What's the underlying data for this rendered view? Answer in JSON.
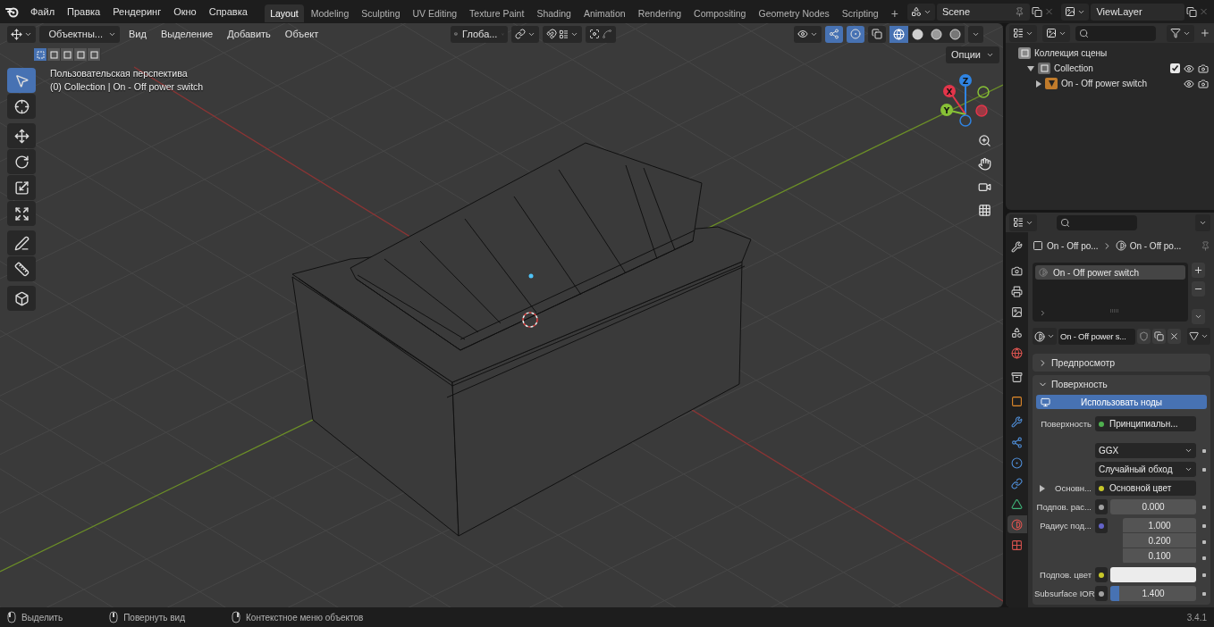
{
  "topbar": {
    "menu": [
      "Файл",
      "Правка",
      "Рендеринг",
      "Окно",
      "Справка"
    ],
    "workspaces": [
      {
        "label": "Layout",
        "selected": true
      },
      {
        "label": "Modeling",
        "selected": false
      },
      {
        "label": "Sculpting",
        "selected": false
      },
      {
        "label": "UV Editing",
        "selected": false
      },
      {
        "label": "Texture Paint",
        "selected": false
      },
      {
        "label": "Shading",
        "selected": false
      },
      {
        "label": "Animation",
        "selected": false
      },
      {
        "label": "Rendering",
        "selected": false
      },
      {
        "label": "Compositing",
        "selected": false
      },
      {
        "label": "Geometry Nodes",
        "selected": false
      },
      {
        "label": "Scripting",
        "selected": false
      }
    ],
    "add_workspace": "+",
    "scene": "Scene",
    "view_layer": "ViewLayer"
  },
  "viewport": {
    "mode": "Объектны...",
    "menus": [
      "Вид",
      "Выделение",
      "Добавить",
      "Объект"
    ],
    "orientation": "Глоба...",
    "select_modes": [
      {
        "selected": true
      },
      {
        "selected": false
      },
      {
        "selected": false
      },
      {
        "selected": false
      },
      {
        "selected": false
      }
    ],
    "gizmos_on": true,
    "overlays_on": true,
    "shading": [
      {
        "kind": "wireframe",
        "selected": true
      },
      {
        "kind": "solid",
        "selected": false
      },
      {
        "kind": "material",
        "selected": false
      },
      {
        "kind": "rendered",
        "selected": false
      }
    ],
    "options": "Опции",
    "view_name": "Пользовательская перспектива",
    "object_info": "(0) Collection | On - Off power switch",
    "tool_groups": [
      [
        {
          "kind": "select",
          "selected": true
        },
        {
          "kind": "cursor",
          "selected": false
        }
      ],
      [
        {
          "kind": "move",
          "selected": false
        },
        {
          "kind": "rotate",
          "selected": false
        },
        {
          "kind": "scale",
          "selected": false
        },
        {
          "kind": "transform",
          "selected": false
        }
      ],
      [
        {
          "kind": "annotate",
          "selected": false
        },
        {
          "kind": "measure",
          "selected": false
        }
      ],
      [
        {
          "kind": "add-cube",
          "selected": false
        }
      ]
    ],
    "axes": [
      {
        "label": "Z",
        "color": "#2f84e3"
      },
      {
        "label": "X",
        "color": "#e3354a"
      },
      {
        "label": "Y",
        "color": "#87c136"
      }
    ]
  },
  "outliner": {
    "items": [
      {
        "kind": "scene-collection",
        "label": "Коллекция сцены",
        "children": [
          {
            "kind": "collection",
            "label": "Collection",
            "expanded": true,
            "checked": true,
            "children": [
              {
                "kind": "object",
                "label": "On - Off power switch",
                "expanded": false
              }
            ]
          }
        ]
      }
    ]
  },
  "properties": {
    "breadcrumb": [
      "On - Off po...",
      "On - Off po..."
    ],
    "tabs": [
      {
        "kind": "tool",
        "selected": false
      },
      {
        "kind": "render",
        "selected": false
      },
      {
        "kind": "output",
        "selected": false
      },
      {
        "kind": "view-layer",
        "selected": false
      },
      {
        "kind": "scene",
        "selected": false
      },
      {
        "kind": "world",
        "selected": false
      },
      {
        "kind": "collection",
        "selected": false
      },
      {
        "kind": "object",
        "selected": false
      },
      {
        "kind": "modifiers",
        "selected": false
      },
      {
        "kind": "particles",
        "selected": false
      },
      {
        "kind": "physics",
        "selected": false
      },
      {
        "kind": "constraints",
        "selected": false
      },
      {
        "kind": "data",
        "selected": false
      },
      {
        "kind": "material",
        "selected": true
      },
      {
        "kind": "texture",
        "selected": false
      }
    ],
    "slots": [
      {
        "label": "On - Off power switch",
        "selected": true
      }
    ],
    "material": "On - Off power s...",
    "panels": [
      {
        "label": "Предпросмотр",
        "expanded": false
      },
      {
        "label": "Поверхность",
        "expanded": true
      }
    ],
    "use_nodes": "Использовать ноды",
    "rows": [
      {
        "kind": "link",
        "label": "Поверхность",
        "color": "#4fb04f",
        "value": "Принципиальн..."
      },
      {
        "kind": "dropdown",
        "value": "GGX"
      },
      {
        "kind": "dropdown",
        "value": "Случайный обход"
      },
      {
        "kind": "link",
        "label": "Основн...",
        "color": "#c7c729",
        "value": "Основной цвет",
        "expanded": false
      },
      {
        "kind": "number",
        "label": "Подпов. рас...",
        "color": "#a1a1a1",
        "value": "0.000"
      },
      {
        "kind": "vector",
        "label": "Радиус под...",
        "color": "#6363c7",
        "values": [
          "1.000",
          "0.200",
          "0.100"
        ]
      },
      {
        "kind": "color",
        "label": "Подпов. цвет",
        "color": "#c7c729",
        "swatch": {
          "color": "#ececec"
        }
      },
      {
        "kind": "slider",
        "label": "Subsurface IOR",
        "color": "#a1a1a1",
        "value": "1.400",
        "level": 0.1
      }
    ]
  },
  "status_bar": {
    "items": [
      {
        "kind": "left",
        "label": "Выделить"
      },
      {
        "kind": "middle",
        "label": "Повернуть вид"
      },
      {
        "kind": "right",
        "label": "Контекстное меню объектов"
      }
    ],
    "version": "3.4.1"
  }
}
